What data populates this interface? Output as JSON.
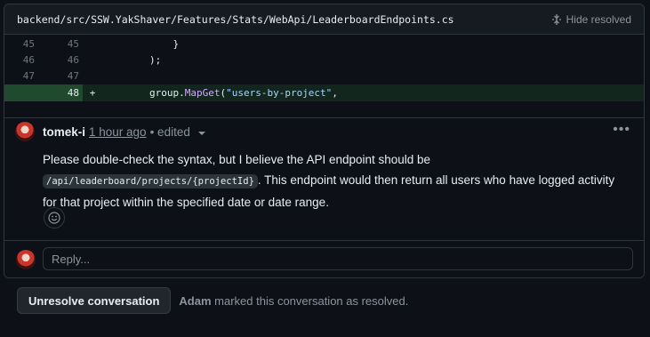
{
  "file": {
    "path": "backend/src/SSW.YakShaver/Features/Stats/WebApi/LeaderboardEndpoints.cs",
    "hide_resolved_label": "Hide resolved"
  },
  "diff": {
    "rows": [
      {
        "old": "45",
        "new": "45",
        "sign": "",
        "code": "            }"
      },
      {
        "old": "46",
        "new": "46",
        "sign": "",
        "code": "        );"
      },
      {
        "old": "47",
        "new": "47",
        "sign": "",
        "code": ""
      },
      {
        "old": "",
        "new": "48",
        "sign": "+",
        "code_prefix": "        group.",
        "code_fn": "MapGet",
        "code_paren": "(",
        "code_str": "\"users-by-project\"",
        "code_suffix": ","
      }
    ]
  },
  "comment": {
    "author": "tomek-i",
    "time": "1 hour ago",
    "edited": "• edited",
    "body_before": "Please double-check the syntax, but I believe the API endpoint should be ",
    "body_code": "/api/leaderboard/projects/{projectId}",
    "body_after": ". This endpoint would then return all users who have logged activity for that project within the specified date or date range."
  },
  "reply": {
    "placeholder": "Reply..."
  },
  "resolution": {
    "button_label": "Unresolve conversation",
    "actor": "Adam",
    "message": "marked this conversation as resolved."
  },
  "icons": {
    "hide_resolved": "fold-icon",
    "menu": "kebab-icon",
    "reaction": "smiley-icon"
  }
}
